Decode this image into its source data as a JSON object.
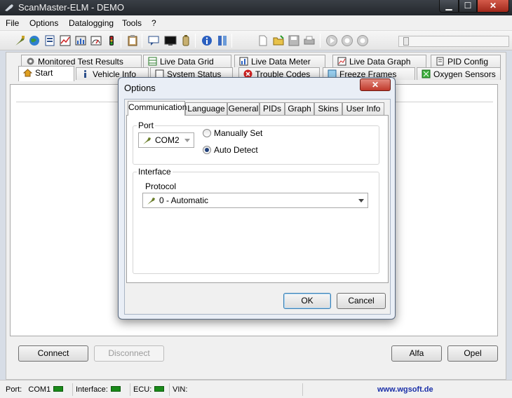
{
  "window": {
    "title": "ScanMaster-ELM - DEMO",
    "minimize": "▁",
    "maximize": "☐",
    "close": "✕"
  },
  "menu": [
    "File",
    "Options",
    "Datalogging",
    "Tools",
    "?"
  ],
  "toolbar": {
    "icons": [
      "connect-plug-icon",
      "globe-icon",
      "document-icon",
      "chart-icon",
      "meter-icon",
      "dtc-icon",
      "clipboard-icon",
      "chat-icon",
      "monitor-icon",
      "battery-icon",
      "info-icon",
      "database-icon",
      "new-file-icon",
      "open-folder-icon",
      "save-icon",
      "print-icon",
      "play-icon",
      "record-icon",
      "stop-icon"
    ]
  },
  "tabs_row1": [
    "Monitored Test Results",
    "Live Data Grid",
    "Live Data Meter",
    "Live Data Graph",
    "PID Config"
  ],
  "tabs_row2": [
    "Start",
    "Vehicle Info",
    "System Status",
    "Trouble Codes",
    "Freeze Frames",
    "Oxygen Sensors"
  ],
  "buttons": {
    "connect": "Connect",
    "disconnect": "Disconnect",
    "alfa": "Alfa",
    "opel": "Opel"
  },
  "statusbar": {
    "port_label": "Port:",
    "port_value": "COM1",
    "interface_label": "Interface:",
    "ecu_label": "ECU:",
    "vin_label": "VIN:",
    "website": "www.wgsoft.de"
  },
  "dialog": {
    "title": "Options",
    "close": "✕",
    "tabs": [
      "Communication",
      "Language",
      "General",
      "PIDs",
      "Graph",
      "Skins",
      "User Info"
    ],
    "port_group": "Port",
    "port_value": "COM2",
    "radio_manual": "Manually Set",
    "radio_auto": "Auto Detect",
    "interface_group": "Interface",
    "protocol_label": "Protocol",
    "protocol_value": "0 - Automatic",
    "ok": "OK",
    "cancel": "Cancel"
  },
  "colors": {
    "status_led": "#1a8a1a",
    "link": "#1a2fa8",
    "close_red": "#c0392b"
  }
}
